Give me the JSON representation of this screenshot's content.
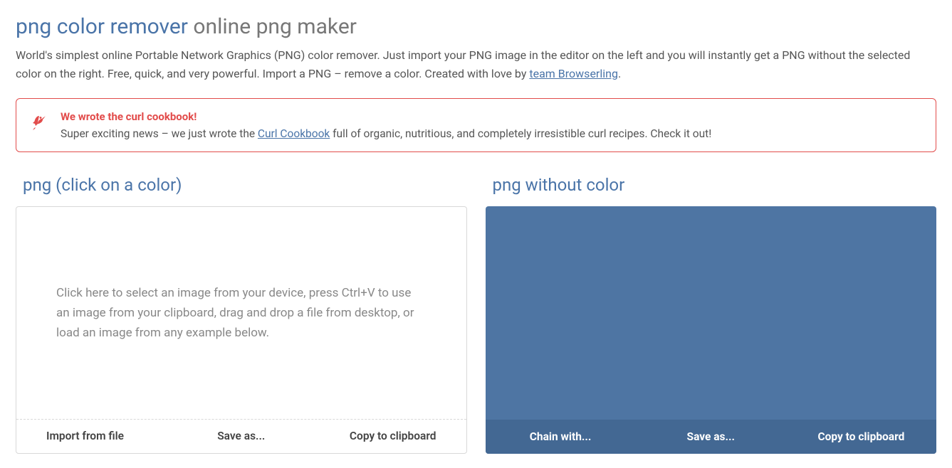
{
  "title": {
    "main": "png color remover",
    "sub": "online png maker"
  },
  "intro": {
    "before_link": "World's simplest online Portable Network Graphics (PNG) color remover. Just import your PNG image in the editor on the left and you will instantly get a PNG without the selected color on the right. Free, quick, and very powerful. Import a PNG – remove a color. Created with love by ",
    "link_text": "team Browserling",
    "after_link": "."
  },
  "alert": {
    "title": "We wrote the curl cookbook!",
    "before_link": "Super exciting news – we just wrote the ",
    "link_text": "Curl Cookbook",
    "after_link": " full of organic, nutritious, and completely irresistible curl recipes. Check it out!"
  },
  "left_panel": {
    "heading": "png (click on a color)",
    "dropzone_text": "Click here to select an image from your device, press Ctrl+V to use an image from your clipboard, drag and drop a file from desktop, or load an image from any example below.",
    "toolbar": {
      "import": "Import from file",
      "save": "Save as...",
      "copy": "Copy to clipboard"
    }
  },
  "right_panel": {
    "heading": "png without color",
    "toolbar": {
      "chain": "Chain with...",
      "save": "Save as...",
      "copy": "Copy to clipboard"
    }
  }
}
